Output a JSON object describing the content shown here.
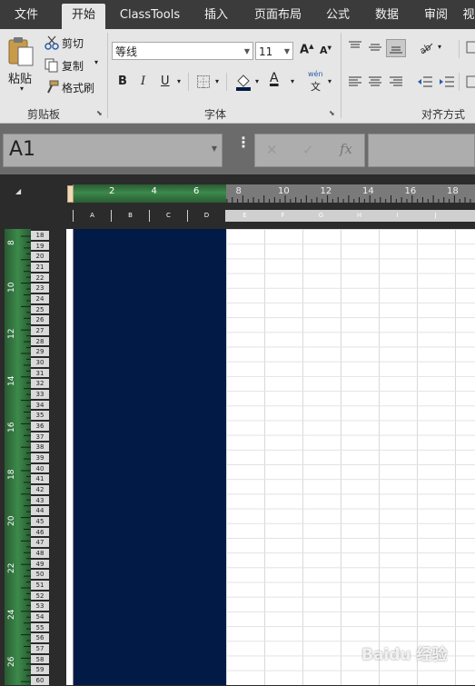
{
  "tabs": [
    "文件",
    "开始",
    "ClassTools",
    "插入",
    "页面布局",
    "公式",
    "数据",
    "审阅",
    "视"
  ],
  "active_tab": "开始",
  "clipboard": {
    "paste_label": "粘贴",
    "cut_label": "剪切",
    "copy_label": "复制",
    "format_painter_label": "格式刷",
    "group_label": "剪贴板"
  },
  "font": {
    "font_name": "等线",
    "font_size": "11",
    "grow_label": "A",
    "shrink_label": "A",
    "bold_label": "B",
    "italic_label": "I",
    "underline_label": "U",
    "font_color_label": "A",
    "phonetic_label": "wén",
    "phonetic_char": "文",
    "group_label": "字体"
  },
  "alignment": {
    "group_label": "对齐方式"
  },
  "formula_bar": {
    "name_box": "A1",
    "cancel_symbol": "✕",
    "enter_symbol": "✓",
    "fx_label": "fx",
    "formula": ""
  },
  "ruler": {
    "h_ticks": [
      "2",
      "4",
      "6",
      "8",
      "10",
      "12",
      "14",
      "16",
      "18"
    ],
    "v_ticks": [
      "8",
      "10",
      "12",
      "14",
      "16",
      "18",
      "20",
      "22",
      "24",
      "26"
    ]
  },
  "columns": [
    "A",
    "B",
    "C",
    "D",
    "E",
    "F",
    "G",
    "H",
    "I",
    "J"
  ],
  "rows": [
    "18",
    "19",
    "20",
    "21",
    "22",
    "23",
    "24",
    "25",
    "26",
    "27",
    "28",
    "29",
    "30",
    "31",
    "32",
    "33",
    "34",
    "35",
    "36",
    "37",
    "38",
    "39",
    "40",
    "41",
    "42",
    "43",
    "44",
    "45",
    "46",
    "47",
    "48",
    "49",
    "50",
    "51",
    "52",
    "53",
    "54",
    "55",
    "56",
    "57",
    "58",
    "59",
    "60"
  ],
  "colors": {
    "fill": "#021a46",
    "ruler_green": "#3c8a4a",
    "tab_bar": "#3b3b3b",
    "ribbon": "#e6e6e6"
  },
  "watermark": "Baidu 经验"
}
